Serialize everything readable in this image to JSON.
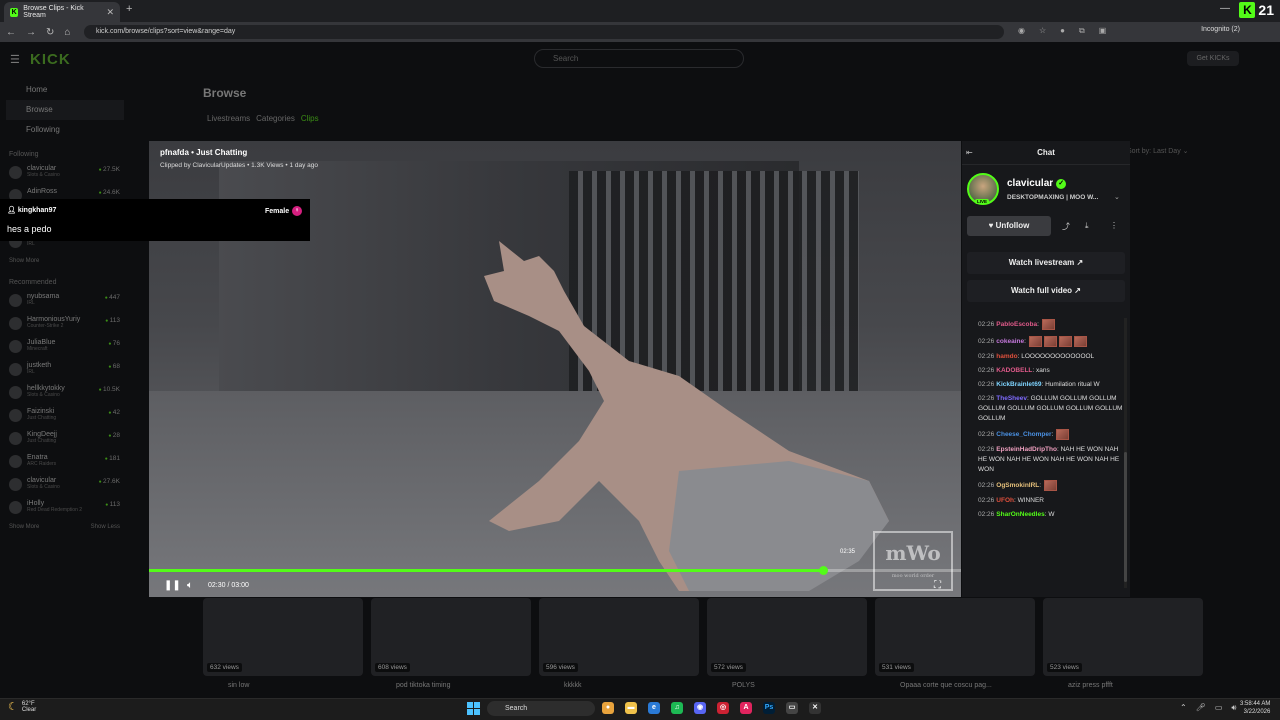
{
  "browser": {
    "tab_title": "Browse Clips - Kick Stream",
    "url": "kick.com/browse/clips?sort=view&range=day",
    "incognito": "Incognito (2)",
    "counter": "21"
  },
  "kick": {
    "logo": "KICK",
    "search_placeholder": "Search",
    "get_kicks": "Get KICKs",
    "nav": [
      "Home",
      "Browse",
      "Following"
    ],
    "following_label": "Following",
    "following": [
      {
        "name": "clavicular",
        "sub": "Slots & Casino",
        "count": "27.5K"
      },
      {
        "name": "AdinRoss",
        "sub": "",
        "count": "24.6K"
      },
      {
        "name": "Cuinam",
        "sub": "Slots & Casino",
        "count": "7.6K"
      },
      {
        "name": "conner",
        "sub": "IRL",
        "count": "1.9K"
      }
    ],
    "show_more_1": "Show More",
    "recommended_label": "Recommended",
    "recommended": [
      {
        "name": "nyubsama",
        "sub": "IRL",
        "count": "447"
      },
      {
        "name": "HarmoniousYuriy",
        "sub": "Counter-Strike 2",
        "count": "113"
      },
      {
        "name": "JuliaBlue",
        "sub": "Minecraft",
        "count": "76"
      },
      {
        "name": "justketh",
        "sub": "IRL",
        "count": "68"
      },
      {
        "name": "hellkkytokky",
        "sub": "Slots & Casino",
        "count": "10.5K"
      },
      {
        "name": "Faizinski",
        "sub": "Just Chatting",
        "count": "42"
      },
      {
        "name": "KingDeejj",
        "sub": "Just Chatting",
        "count": "28"
      },
      {
        "name": "Enatra",
        "sub": "ARC Raiders",
        "count": "181"
      },
      {
        "name": "clavicular",
        "sub": "Slots & Casino",
        "count": "27.6K"
      },
      {
        "name": "iHolly",
        "sub": "Red Dead Redemption 2",
        "count": "113"
      }
    ],
    "show_more_2": "Show More",
    "show_less": "Show Less",
    "browse_title": "Browse",
    "tabs": [
      "Livestreams",
      "Categories",
      "Clips"
    ],
    "sort_label": "Sort by:",
    "sort_value": "Last Day",
    "thumbs": [
      {
        "views": "632 views",
        "title": "sin low"
      },
      {
        "views": "608 views",
        "title": "pod tiktoka timing"
      },
      {
        "views": "596 views",
        "title": "kkkkk"
      },
      {
        "views": "572 views",
        "title": "POLYS"
      },
      {
        "views": "531 views",
        "title": "Opaaa corte que coscu pag..."
      },
      {
        "views": "523 views",
        "title": "aziz press pffft"
      }
    ]
  },
  "video": {
    "title": "pfnafda • Just Chatting",
    "subtitle": "Clipped by ClavicularUpdates • 1.3K Views • 1 day ago",
    "time": "02:30 / 03:00",
    "hover_time": "02:35",
    "progress": 0.83,
    "watermark": "mWo",
    "watermark_sub": "moo world order"
  },
  "popup": {
    "user": "kingkhan97",
    "gender": "Female",
    "message": "hes a pedo"
  },
  "chat": {
    "header": "Chat",
    "channel": "clavicular",
    "live": "LIVE",
    "stream_title": "DESKTOPMAXING | MOO W...",
    "unfollow": "Unfollow",
    "watch_live": "Watch livestream",
    "watch_full": "Watch full video",
    "messages": [
      {
        "time": "02:26",
        "user": "PabloEscoba",
        "color": "#e05a8a",
        "text": "",
        "emotes": 1
      },
      {
        "time": "02:26",
        "user": "cokeaine",
        "color": "#c678dd",
        "text": "",
        "emotes": 4
      },
      {
        "time": "02:26",
        "user": "hamdo",
        "color": "#e0503c",
        "text": "LOOOOOOOOOOOOOL",
        "emotes": 0
      },
      {
        "time": "02:26",
        "user": "KADOBELL",
        "color": "#e05a8a",
        "text": "xans",
        "emotes": 0
      },
      {
        "time": "02:26",
        "user": "KickBrainlet69",
        "color": "#7fd4ff",
        "text": "Humilation ritual W",
        "emotes": 0
      },
      {
        "time": "02:26",
        "user": "TheSheev",
        "color": "#7f6bff",
        "text": "GOLLUM  GOLLUM  GOLLUM  GOLLUM  GOLLUM  GOLLUM  GOLLUM  GOLLUM  GOLLUM",
        "emotes": 0
      },
      {
        "time": "02:26",
        "user": "Cheese_Chomper",
        "color": "#4a90e2",
        "text": "",
        "emotes": 1
      },
      {
        "time": "02:26",
        "user": "EpsteinHadDripTho",
        "color": "#f0a0c0",
        "text": "NAH HE WON  NAH HE WON  NAH HE WON  NAH HE WON  NAH HE WON",
        "emotes": 0
      },
      {
        "time": "02:26",
        "user": "OgSmokinIRL",
        "color": "#e5c07b",
        "text": "",
        "emotes": 1
      },
      {
        "time": "02:26",
        "user": "UFOh",
        "color": "#e0503c",
        "text": "WINNER",
        "emotes": 0
      },
      {
        "time": "02:26",
        "user": "SharOnNeedles",
        "color": "#53fc18",
        "text": "W",
        "emotes": 0
      }
    ]
  },
  "taskbar": {
    "temp": "62°F",
    "weather": "Clear",
    "search": "Search",
    "time": "3:58:44 AM",
    "date": "3/22/2026"
  }
}
